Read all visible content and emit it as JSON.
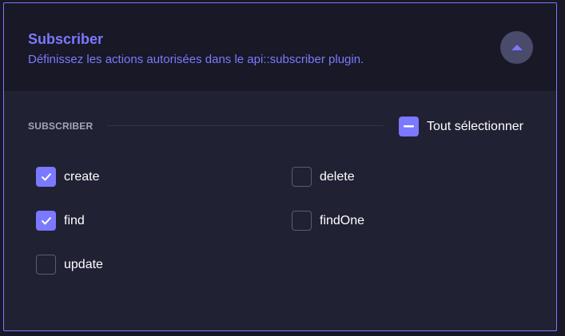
{
  "header": {
    "title": "Subscriber",
    "subtitle": "Définissez les actions autorisées dans le api::subscriber plugin.",
    "collapse_icon": "chevron-up-icon"
  },
  "section": {
    "label": "SUBSCRIBER",
    "select_all_label": "Tout sélectionner",
    "select_all_state": "indeterminate"
  },
  "permissions": [
    {
      "label": "create",
      "checked": true
    },
    {
      "label": "delete",
      "checked": false
    },
    {
      "label": "find",
      "checked": true
    },
    {
      "label": "findOne",
      "checked": false
    },
    {
      "label": "update",
      "checked": false
    }
  ],
  "colors": {
    "accent": "#7b79ff",
    "header_bg": "#181826",
    "panel_bg": "#212134",
    "checkbox_border": "#5a5a77"
  }
}
